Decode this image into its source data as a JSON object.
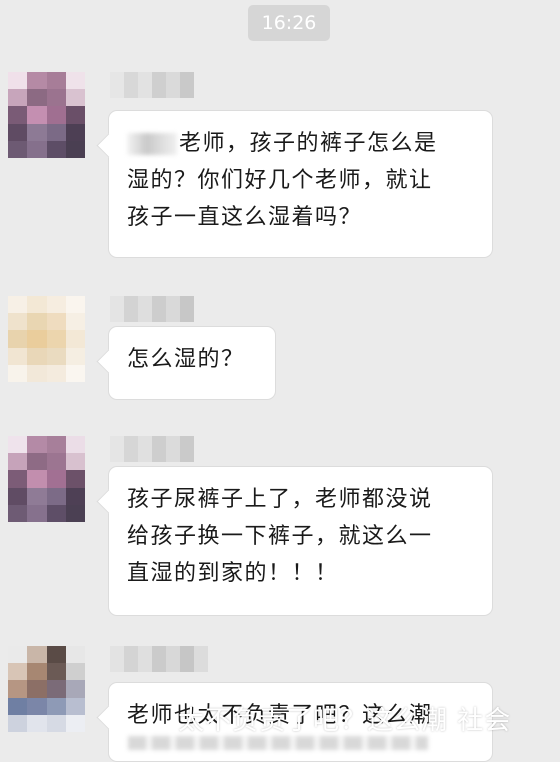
{
  "chat": {
    "timestamp": "16:26",
    "messages": [
      {
        "lines": [
          "老师，孩子的裤子怎么是",
          "湿的？你们好几个老师，就让",
          "孩子一直这么湿着吗？"
        ]
      },
      {
        "lines": [
          "怎么湿的？"
        ]
      },
      {
        "lines": [
          "孩子尿裤子上了，老师都没说",
          "给孩子换一下裤子，就这么一",
          "直湿的到家的！！！"
        ]
      },
      {
        "lines": [
          "老师也太不负责了吧？这么潮"
        ]
      }
    ]
  },
  "watermark": {
    "text": "太不负责了吧？这么潮 社会"
  },
  "colors": {
    "background": "#ebebeb",
    "bubble": "#ffffff",
    "timestamp_bg": "#d6d6d6",
    "text": "#1a1a1a"
  },
  "icons": {
    "avatar": "pixelated-avatar-icon"
  }
}
